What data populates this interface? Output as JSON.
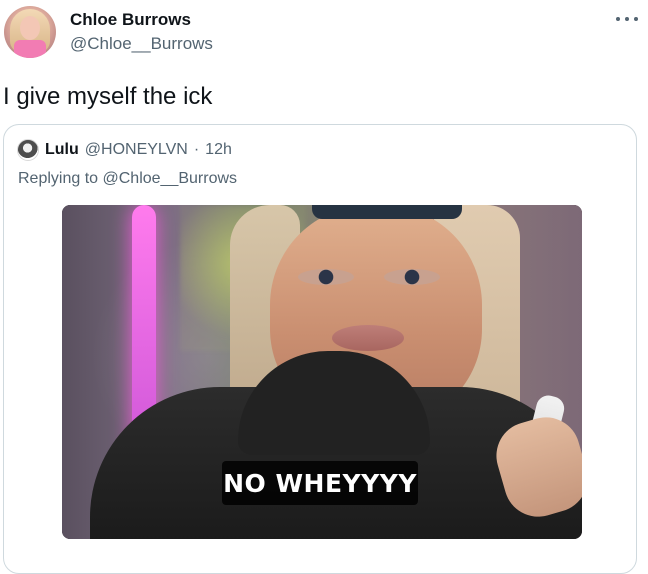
{
  "author": {
    "name": "Chloe Burrows",
    "handle": "@Chloe__Burrows"
  },
  "tweet": {
    "text": "I give myself the ick"
  },
  "quoted": {
    "name": "Lulu",
    "handle": "@HONEYLVN",
    "dot": "·",
    "time": "12h",
    "replying_to": "Replying to",
    "reply_handle": "@Chloe__Burrows",
    "caption": "NO WHEYYYY"
  },
  "icons": {
    "more": "more-horizontal-icon"
  },
  "colors": {
    "primary_text": "#0f1419",
    "secondary_text": "#536471",
    "border": "#cfd9de",
    "caption_bg": "#000000",
    "caption_text": "#ffffff"
  }
}
